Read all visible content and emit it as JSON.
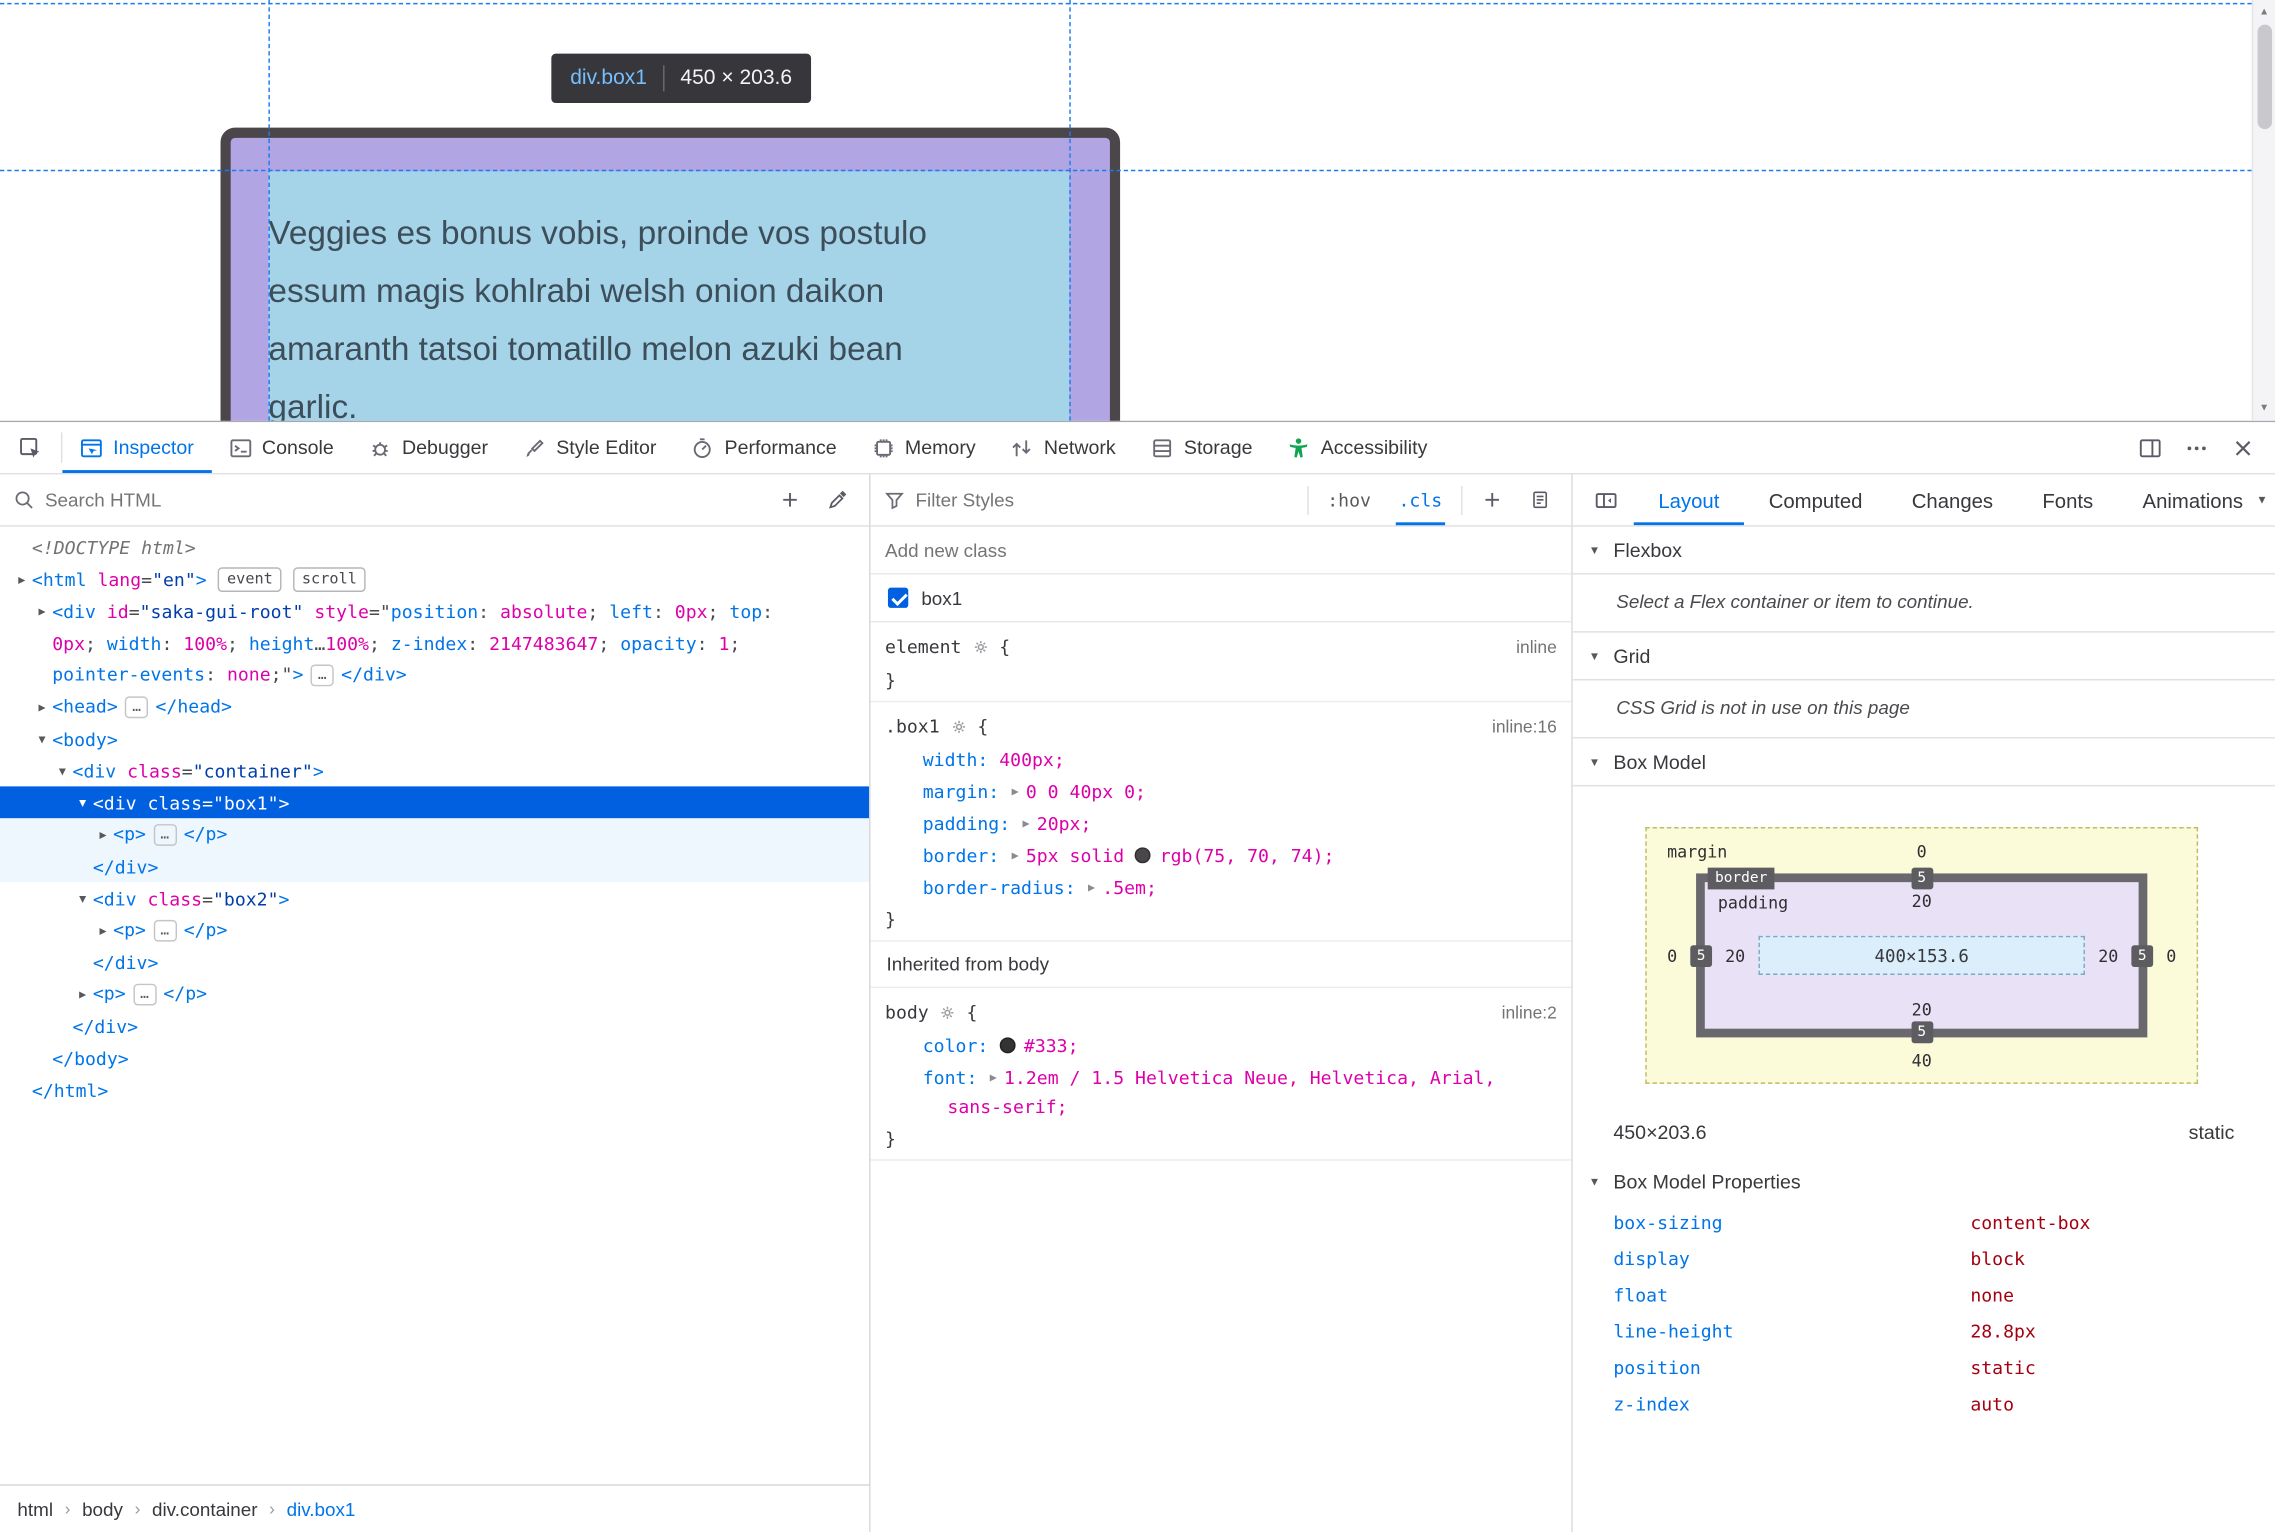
{
  "colors": {
    "accent_blue": "#0074e8",
    "selection_blue": "#0060df",
    "attr_magenta": "#dd00a9",
    "attr_value_navy": "#003eaa",
    "computed_value_red": "#a4000f",
    "accessibility_green": "#12a452",
    "highlight_content_blue": "#a5d4e9",
    "highlight_padding_purple": "#b1a5e3",
    "guide_blue": "#1d7bf0",
    "border_swatch": "#4b464a",
    "body_color_swatch": "#333333"
  },
  "page": {
    "tooltip": {
      "selector": "div.box1",
      "dimensions": "450 × 203.6"
    },
    "content_lines": [
      "Veggies es bonus vobis, proinde vos postulo",
      "essum magis kohlrabi welsh onion daikon",
      "amaranth tatsoi tomatillo melon azuki bean",
      "garlic."
    ]
  },
  "toolbar": {
    "tabs": [
      {
        "label": "Inspector",
        "icon": "inspector",
        "active": true
      },
      {
        "label": "Console",
        "icon": "console"
      },
      {
        "label": "Debugger",
        "icon": "debugger"
      },
      {
        "label": "Style Editor",
        "icon": "style-editor"
      },
      {
        "label": "Performance",
        "icon": "performance"
      },
      {
        "label": "Memory",
        "icon": "memory"
      },
      {
        "label": "Network",
        "icon": "network"
      },
      {
        "label": "Storage",
        "icon": "storage"
      },
      {
        "label": "Accessibility",
        "icon": "accessibility"
      }
    ]
  },
  "markup": {
    "search_placeholder": "Search HTML",
    "lines": [
      {
        "d": 0,
        "seg": [
          [
            "g",
            "<!DOCTYPE html>"
          ]
        ]
      },
      {
        "d": 0,
        "a": "r",
        "seg": [
          [
            "t",
            "<html"
          ],
          [
            "p",
            " "
          ],
          [
            "a",
            "lang"
          ],
          [
            "p",
            "="
          ],
          [
            "v",
            "\"en\""
          ],
          [
            "t",
            ">"
          ]
        ],
        "badges": [
          "event",
          "scroll"
        ]
      },
      {
        "d": 1,
        "a": "r",
        "seg": [
          [
            "t",
            "<div"
          ],
          [
            "p",
            " "
          ],
          [
            "a",
            "id"
          ],
          [
            "p",
            "="
          ],
          [
            "v",
            "\"saka-gui-root\""
          ],
          [
            "p",
            " "
          ],
          [
            "a",
            "style"
          ],
          [
            "p",
            "=\""
          ],
          [
            "n",
            "position"
          ],
          [
            "p",
            ": "
          ],
          [
            "m",
            "absolute"
          ],
          [
            "p",
            "; "
          ],
          [
            "n",
            "left"
          ],
          [
            "p",
            ": "
          ],
          [
            "m",
            "0px"
          ],
          [
            "p",
            "; "
          ],
          [
            "n",
            "top"
          ],
          [
            "p",
            ":"
          ]
        ]
      },
      {
        "d": 1,
        "seg": [
          [
            "m",
            "0px"
          ],
          [
            "p",
            "; "
          ],
          [
            "n",
            "width"
          ],
          [
            "p",
            ": "
          ],
          [
            "m",
            "100%"
          ],
          [
            "p",
            "; "
          ],
          [
            "n",
            "height"
          ],
          [
            "p",
            "…"
          ],
          [
            "m",
            "100%"
          ],
          [
            "p",
            "; "
          ],
          [
            "n",
            "z-index"
          ],
          [
            "p",
            ": "
          ],
          [
            "m",
            "2147483647"
          ],
          [
            "p",
            "; "
          ],
          [
            "n",
            "opacity"
          ],
          [
            "p",
            ": "
          ],
          [
            "m",
            "1"
          ],
          [
            "p",
            ";"
          ]
        ]
      },
      {
        "d": 1,
        "seg": [
          [
            "n",
            "pointer-events"
          ],
          [
            "p",
            ": "
          ],
          [
            "m",
            "none"
          ],
          [
            "p",
            ";\""
          ],
          [
            "t",
            ">"
          ],
          [
            "e",
            "…"
          ],
          [
            "t",
            "</div>"
          ]
        ]
      },
      {
        "d": 1,
        "a": "r",
        "seg": [
          [
            "t",
            "<head>"
          ],
          [
            "e",
            "…"
          ],
          [
            "t",
            "</head>"
          ]
        ]
      },
      {
        "d": 1,
        "a": "d",
        "seg": [
          [
            "t",
            "<body>"
          ]
        ]
      },
      {
        "d": 2,
        "a": "d",
        "seg": [
          [
            "t",
            "<div"
          ],
          [
            "p",
            " "
          ],
          [
            "a",
            "class"
          ],
          [
            "p",
            "="
          ],
          [
            "v",
            "\"container\""
          ],
          [
            "t",
            ">"
          ]
        ]
      },
      {
        "d": 3,
        "a": "d",
        "sel": true,
        "seg": [
          [
            "t",
            "<div"
          ],
          [
            "p",
            " "
          ],
          [
            "a",
            "class"
          ],
          [
            "p",
            "="
          ],
          [
            "v",
            "\"box1\""
          ],
          [
            "t",
            ">"
          ]
        ]
      },
      {
        "d": 4,
        "a": "r",
        "sh": true,
        "seg": [
          [
            "t",
            "<p>"
          ],
          [
            "e",
            "…"
          ],
          [
            "t",
            "</p>"
          ]
        ]
      },
      {
        "d": 3,
        "sh": true,
        "seg": [
          [
            "t",
            "</div>"
          ]
        ]
      },
      {
        "d": 3,
        "a": "d",
        "seg": [
          [
            "t",
            "<div"
          ],
          [
            "p",
            " "
          ],
          [
            "a",
            "class"
          ],
          [
            "p",
            "="
          ],
          [
            "v",
            "\"box2\""
          ],
          [
            "t",
            ">"
          ]
        ]
      },
      {
        "d": 4,
        "a": "r",
        "seg": [
          [
            "t",
            "<p>"
          ],
          [
            "e",
            "…"
          ],
          [
            "t",
            "</p>"
          ]
        ]
      },
      {
        "d": 3,
        "seg": [
          [
            "t",
            "</div>"
          ]
        ]
      },
      {
        "d": 3,
        "a": "r",
        "seg": [
          [
            "t",
            "<p>"
          ],
          [
            "e",
            "…"
          ],
          [
            "t",
            "</p>"
          ]
        ]
      },
      {
        "d": 2,
        "seg": [
          [
            "t",
            "</div>"
          ]
        ]
      },
      {
        "d": 1,
        "seg": [
          [
            "t",
            "</body>"
          ]
        ]
      },
      {
        "d": 0,
        "seg": [
          [
            "t",
            "</html>"
          ]
        ]
      }
    ]
  },
  "breadcrumb": {
    "items": [
      {
        "label": "html"
      },
      {
        "label": "body"
      },
      {
        "label": "div.container"
      },
      {
        "label": "div.box1",
        "active": true
      }
    ]
  },
  "rules": {
    "filter_placeholder": "Filter Styles",
    "pseudo_button": ":hov",
    "class_button": ".cls",
    "add_class_placeholder": "Add new class",
    "class_checkbox_label": "box1",
    "inherited_header": "Inherited from body",
    "blocks": [
      {
        "selector": "element",
        "link": "inline",
        "props": []
      },
      {
        "selector": ".box1",
        "link": "inline:16",
        "props": [
          {
            "name": "width",
            "tokens": [
              [
                "val",
                "400px;"
              ]
            ]
          },
          {
            "name": "margin",
            "tokens": [
              [
                "arrow"
              ],
              [
                "val",
                "0 0 40px 0;"
              ]
            ]
          },
          {
            "name": "padding",
            "tokens": [
              [
                "arrow"
              ],
              [
                "val",
                "20px;"
              ]
            ]
          },
          {
            "name": "border",
            "tokens": [
              [
                "arrow"
              ],
              [
                "val",
                "5px solid "
              ],
              [
                "swatch",
                "#4b464a"
              ],
              [
                "val",
                "rgb(75, 70, 74);"
              ]
            ]
          },
          {
            "name": "border-radius",
            "tokens": [
              [
                "arrow"
              ],
              [
                "val",
                ".5em;"
              ]
            ]
          }
        ]
      },
      {
        "selector": "body",
        "link": "inline:2",
        "inherited": true,
        "props": [
          {
            "name": "color",
            "tokens": [
              [
                "swatch",
                "#333333"
              ],
              [
                "val",
                "#333;"
              ]
            ]
          },
          {
            "name": "font",
            "tokens": [
              [
                "arrow"
              ],
              [
                "val",
                "1.2em / 1.5 Helvetica Neue, Helvetica, Arial,"
              ]
            ],
            "wrap": "sans-serif;"
          }
        ]
      }
    ]
  },
  "layout_pane": {
    "tabs": [
      {
        "label": "Layout",
        "active": true
      },
      {
        "label": "Computed"
      },
      {
        "label": "Changes"
      },
      {
        "label": "Fonts"
      },
      {
        "label": "Animations"
      }
    ],
    "flexbox": {
      "title": "Flexbox",
      "message": "Select a Flex container or item to continue."
    },
    "grid": {
      "title": "Grid",
      "message": "CSS Grid is not in use on this page"
    },
    "box_model": {
      "title": "Box Model",
      "labels": {
        "margin": "margin",
        "border": "border",
        "padding": "padding"
      },
      "margin": {
        "top": "0",
        "right": "0",
        "bottom": "40",
        "left": "0"
      },
      "border": {
        "top": "5",
        "right": "5",
        "bottom": "5",
        "left": "5"
      },
      "padding": {
        "top": "20",
        "right": "20",
        "bottom": "20",
        "left": "20"
      },
      "content": "400×153.6",
      "dimensions": "450×203.6",
      "position": "static",
      "properties_title": "Box Model Properties",
      "properties": [
        {
          "name": "box-sizing",
          "value": "content-box"
        },
        {
          "name": "display",
          "value": "block"
        },
        {
          "name": "float",
          "value": "none"
        },
        {
          "name": "line-height",
          "value": "28.8px"
        },
        {
          "name": "position",
          "value": "static"
        },
        {
          "name": "z-index",
          "value": "auto"
        }
      ]
    }
  }
}
